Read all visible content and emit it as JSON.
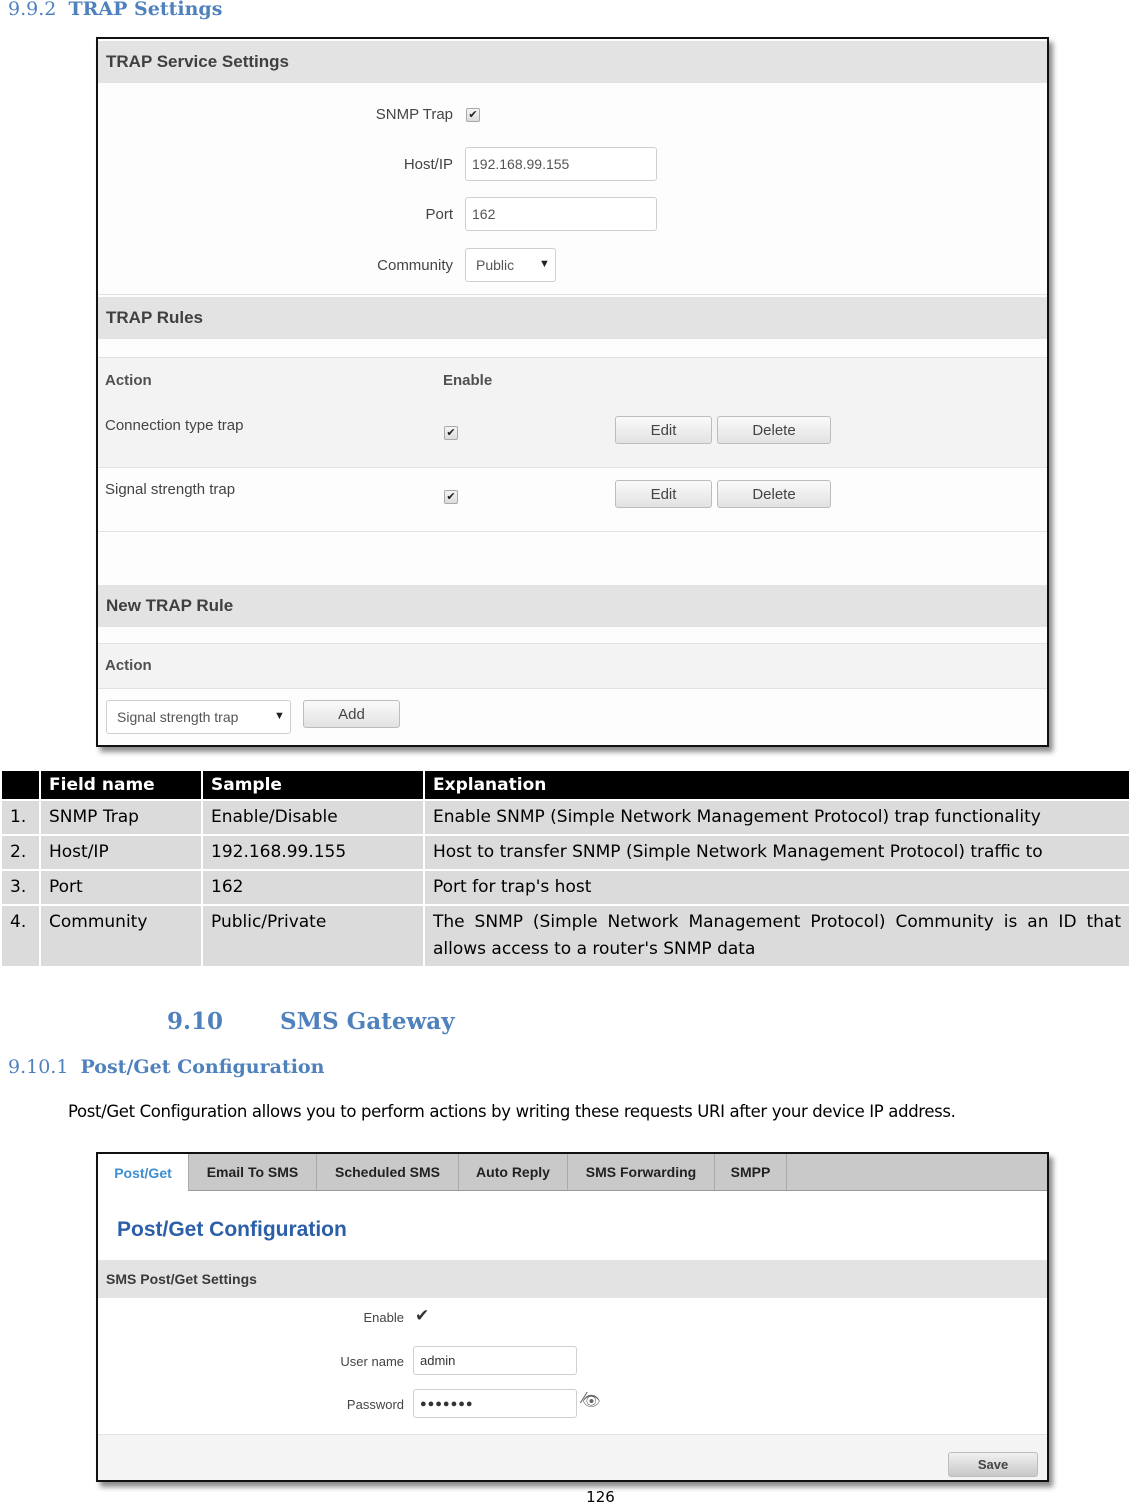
{
  "section_992": {
    "number": "9.9.2",
    "title": "TRAP Settings"
  },
  "trap_ui": {
    "service_settings": {
      "heading": "TRAP Service Settings",
      "snmp_trap_label": "SNMP Trap",
      "snmp_trap_checked": true,
      "host_label": "Host/IP",
      "host_value": "192.168.99.155",
      "port_label": "Port",
      "port_value": "162",
      "community_label": "Community",
      "community_value": "Public"
    },
    "rules": {
      "heading": "TRAP Rules",
      "col_action": "Action",
      "col_enable": "Enable",
      "rows": [
        {
          "action": "Connection type trap",
          "enabled": true,
          "edit": "Edit",
          "delete": "Delete"
        },
        {
          "action": "Signal strength trap",
          "enabled": true,
          "edit": "Edit",
          "delete": "Delete"
        }
      ]
    },
    "new_rule": {
      "heading": "New TRAP Rule",
      "col_action": "Action",
      "select_value": "Signal strength trap",
      "add_label": "Add"
    }
  },
  "field_table": {
    "headers": [
      "",
      "Field name",
      "Sample",
      "Explanation"
    ],
    "rows": [
      [
        "1.",
        "SNMP Trap",
        "Enable/Disable",
        "Enable SNMP (Simple Network Management Protocol) trap functionality"
      ],
      [
        "2.",
        "Host/IP",
        "192.168.99.155",
        "Host to transfer SNMP (Simple Network Management Protocol) traffic to"
      ],
      [
        "3.",
        "Port",
        "162",
        "Port for trap's host"
      ],
      [
        "4.",
        "Community",
        "Public/Private",
        "The SNMP (Simple Network Management Protocol) Community is an ID that allows access to a router's SNMP data"
      ]
    ]
  },
  "section_910": {
    "number": "9.10",
    "title": "SMS Gateway"
  },
  "section_9101": {
    "number": "9.10.1",
    "title": "Post/Get Configuration"
  },
  "intro_text": "Post/Get Configuration allows you to perform actions by writing these requests URI after your device IP address.",
  "sms_ui": {
    "tabs": [
      "Post/Get",
      "Email To SMS",
      "Scheduled SMS",
      "Auto Reply",
      "SMS Forwarding",
      "SMPP"
    ],
    "active_tab": "Post/Get",
    "page_title": "Post/Get Configuration",
    "settings_heading": "SMS Post/Get Settings",
    "enable_label": "Enable",
    "enable_checked": true,
    "username_label": "User name",
    "username_value": "admin",
    "password_label": "Password",
    "password_value": "●●●●●●●",
    "save_label": "Save",
    "accent_color": "#3d8fd1"
  },
  "page_number": "126"
}
